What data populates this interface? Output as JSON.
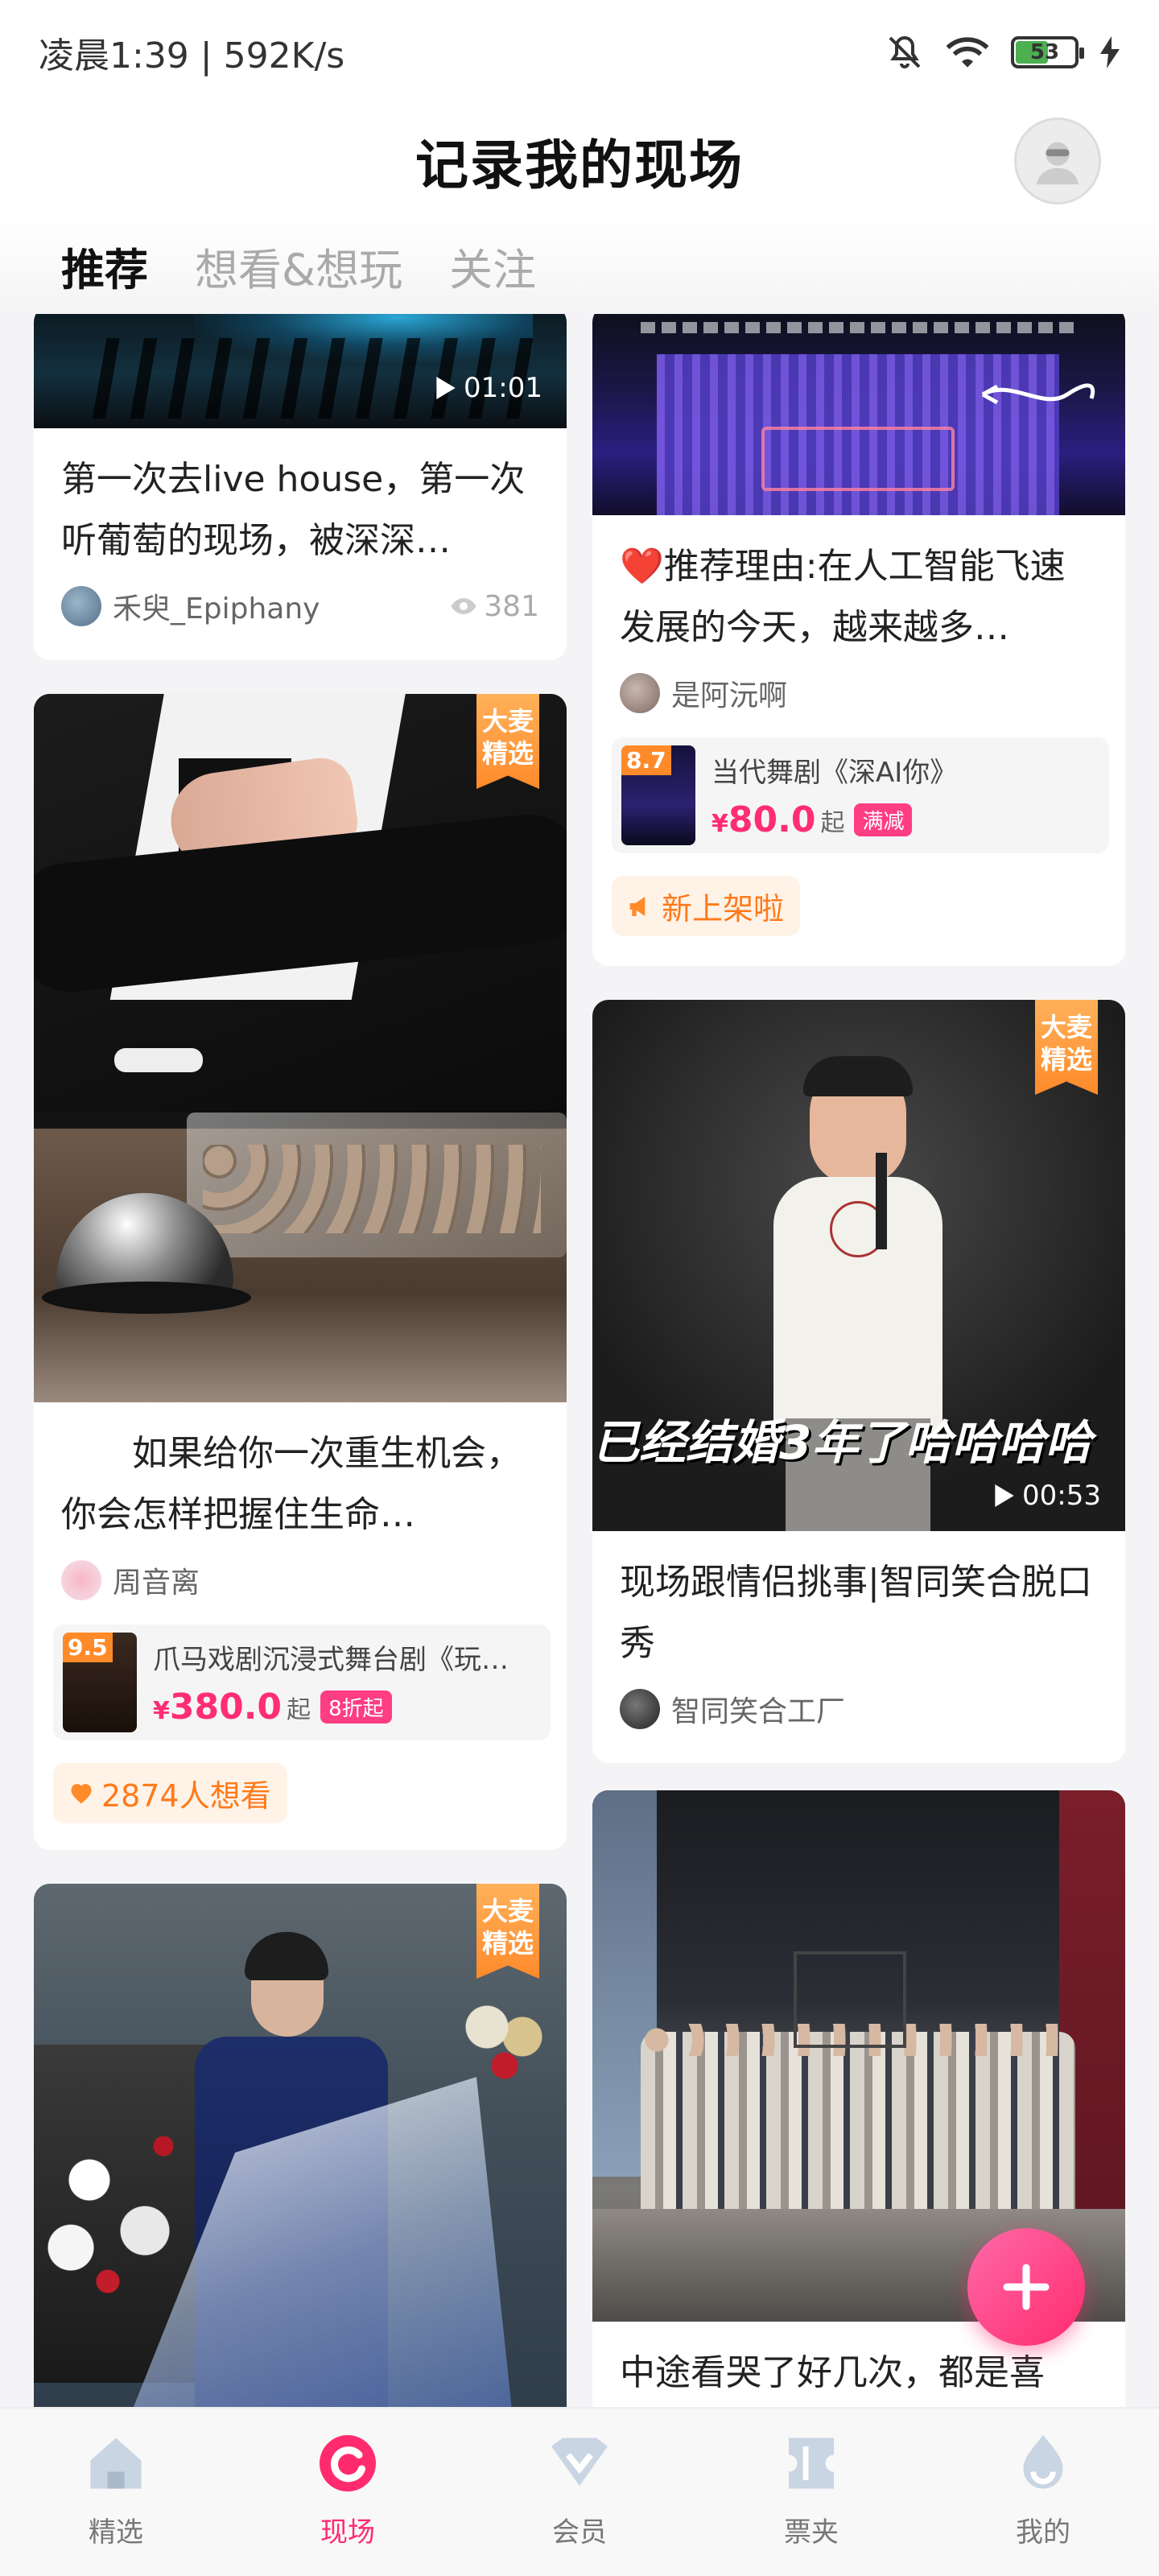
{
  "status_bar": {
    "time_and_speed": "凌晨1:39 | 592K/s",
    "battery": "53"
  },
  "header": {
    "title": "记录我的现场"
  },
  "tabs": [
    {
      "label": "推荐",
      "active": true
    },
    {
      "label": "想看&想玩",
      "active": false
    },
    {
      "label": "关注",
      "active": false
    }
  ],
  "feed": {
    "left": [
      {
        "title": "第一次去live house，第一次听葡萄的现场，被深深…",
        "duration": "01:01",
        "author": "禾臾_Epiphany",
        "views": "381"
      },
      {
        "badge": [
          "大麦",
          "精选"
        ],
        "title": "　　如果给你一次重生机会，你会怎样把握住生命…",
        "author": "周音离",
        "ticket": {
          "score": "9.5",
          "name": "爪马戏剧沉浸式舞台剧《玩…",
          "price_symbol": "¥",
          "price": "380.0",
          "suffix": "起",
          "tag": "8折起"
        },
        "chip": "2874人想看"
      },
      {
        "badge": [
          "大麦",
          "精选"
        ]
      }
    ],
    "right": [
      {
        "title": "❤️推荐理由:在人工智能飞速发展的今天，越来越多…",
        "author": "是阿沅啊",
        "ticket": {
          "score": "8.7",
          "name": "当代舞剧《深AI你》",
          "price_symbol": "¥",
          "price": "80.0",
          "suffix": "起",
          "tag": "满减"
        },
        "chip": "新上架啦"
      },
      {
        "badge": [
          "大麦",
          "精选"
        ],
        "overlay_text": "已经结婚3年了哈哈哈哈",
        "duration": "00:53",
        "title": "现场跟情侣挑事|智同笑合脱口秀",
        "author": "智同笑合工厂"
      },
      {
        "title": "中途看哭了好几次，都是喜"
      }
    ]
  },
  "bottom_nav": [
    {
      "label": "精选",
      "icon": "home-icon",
      "active": false
    },
    {
      "label": "现场",
      "icon": "live-icon",
      "active": true
    },
    {
      "label": "会员",
      "icon": "vip-icon",
      "active": false
    },
    {
      "label": "票夹",
      "icon": "ticket-icon",
      "active": false
    },
    {
      "label": "我的",
      "icon": "profile-icon",
      "active": false
    }
  ],
  "colors": {
    "accent": "#ff2b6e",
    "badge_orange": "#ff8a2a"
  }
}
